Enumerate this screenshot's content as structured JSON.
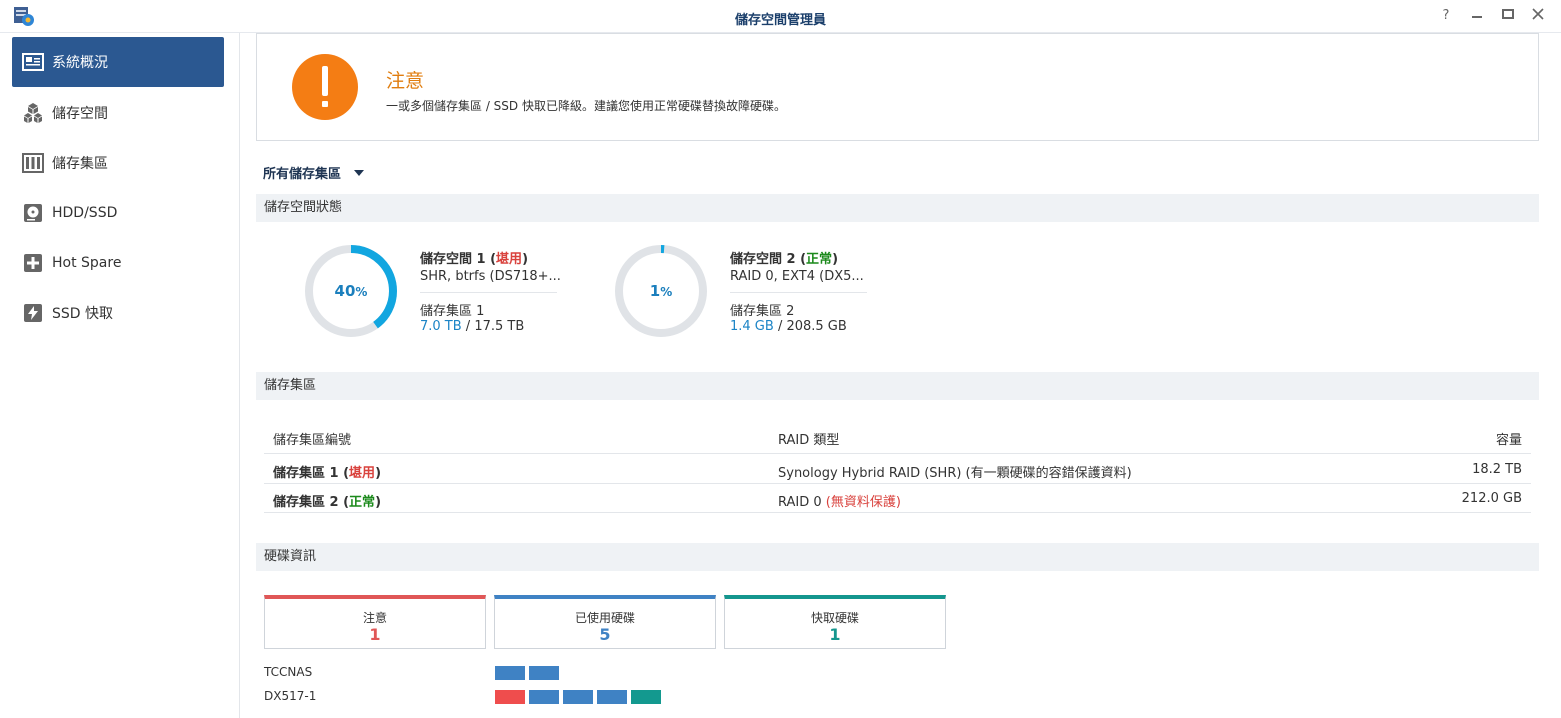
{
  "window": {
    "title": "儲存空間管理員"
  },
  "sidebar": {
    "items": [
      {
        "label": "系統概況",
        "icon": "overview-icon"
      },
      {
        "label": "儲存空間",
        "icon": "cubes-icon"
      },
      {
        "label": "儲存集區",
        "icon": "pool-icon"
      },
      {
        "label": "HDD/SSD",
        "icon": "disk-icon"
      },
      {
        "label": "Hot Spare",
        "icon": "hotspare-icon"
      },
      {
        "label": "SSD 快取",
        "icon": "ssd-cache-icon"
      }
    ]
  },
  "alert": {
    "title": "注意",
    "message": "一或多個儲存集區 / SSD 快取已降級。建議您使用正常硬碟替換故障硬碟。",
    "color": "#f47d14"
  },
  "filter": {
    "label": "所有儲存集區"
  },
  "volume_section": {
    "title": "儲存空間狀態"
  },
  "volumes": [
    {
      "percent_num": "40",
      "percent_sign": "%",
      "used_fraction": 0.4,
      "name": "儲存空間 1",
      "status_open": " (",
      "status": "堪用",
      "status_close": ")",
      "desc": "SHR, btrfs (DS718+...",
      "pool": "儲存集區 1",
      "used": "7.0 TB",
      "total": " / 17.5 TB"
    },
    {
      "percent_num": "1",
      "percent_sign": "%",
      "used_fraction": 0.01,
      "name": "儲存空間 2",
      "status_open": " (",
      "status": "正常",
      "status_close": ")",
      "desc": "RAID 0, EXT4 (DX5...",
      "pool": "儲存集區 2",
      "used": "1.4 GB",
      "total": " / 208.5 GB"
    }
  ],
  "pool_section": {
    "title": "儲存集區"
  },
  "pool_table": {
    "headers": {
      "id": "儲存集區編號",
      "raid": "RAID 類型",
      "capacity": "容量"
    },
    "rows": [
      {
        "name": "儲存集區 1",
        "status_open": " (",
        "status": "堪用",
        "status_close": ")",
        "raid": "Synology Hybrid RAID (SHR) (有一顆硬碟的容錯保護資料)",
        "raid_note": "",
        "capacity": "18.2 TB"
      },
      {
        "name": "儲存集區 2",
        "status_open": " (",
        "status": "正常",
        "status_close": ")",
        "raid": "RAID 0 ",
        "raid_note": "(無資料保護)",
        "capacity": "212.0 GB"
      }
    ]
  },
  "disk_section": {
    "title": "硬碟資訊"
  },
  "disk_summary": [
    {
      "label": "注意",
      "count": "1",
      "color": "#e05757"
    },
    {
      "label": "已使用硬碟",
      "count": "5",
      "color": "#3f82c4"
    },
    {
      "label": "快取硬碟",
      "count": "1",
      "color": "#14968e"
    }
  ],
  "hosts": [
    {
      "name": "TCCNAS",
      "slots": [
        "used",
        "used"
      ]
    },
    {
      "name": "DX517-1",
      "slots": [
        "warning",
        "used",
        "used",
        "used",
        "cache"
      ]
    }
  ],
  "slot_colors": {
    "used": "#3f82c4",
    "warning": "#ef4d4d",
    "cache": "#13998f"
  }
}
